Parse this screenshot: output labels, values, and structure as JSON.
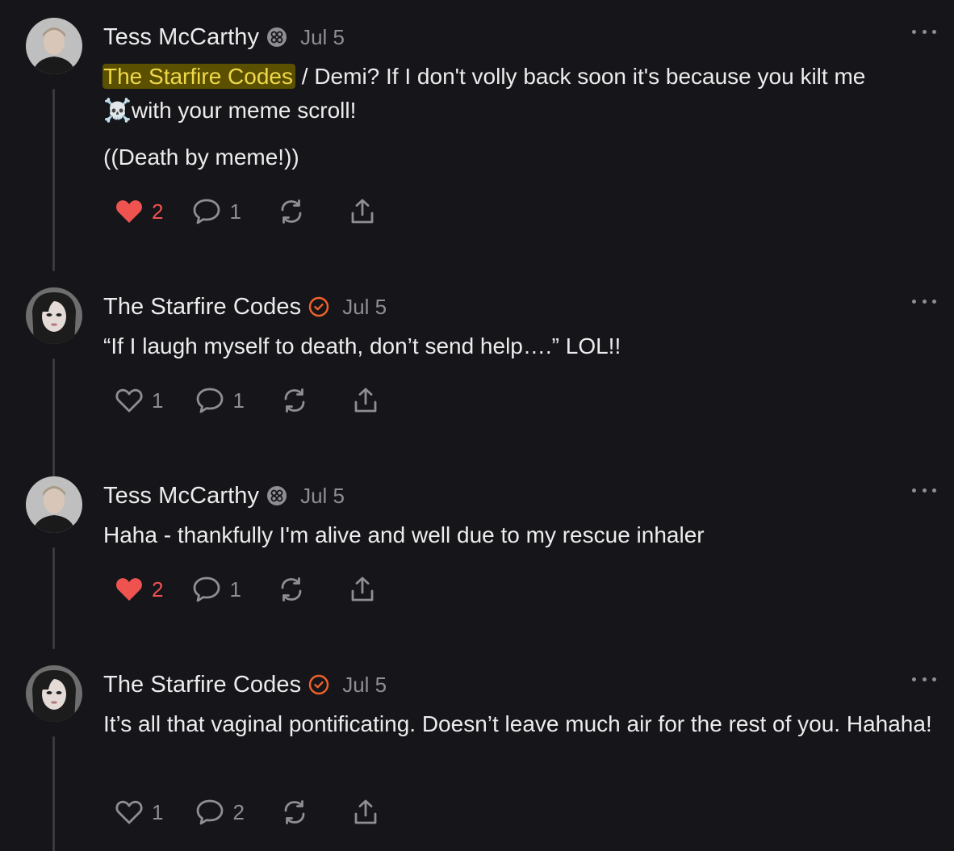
{
  "comments": [
    {
      "author": "Tess McCarthy",
      "date": "Jul 5",
      "mention": "The Starfire Codes",
      "line1": " / Demi? If I don't volly back soon it's because you kilt me ☠️with your meme scroll!",
      "line2": "((Death by meme!))",
      "likes": "2",
      "liked": true,
      "replies": "1"
    },
    {
      "author": "The Starfire Codes",
      "date": "Jul 5",
      "line1": "“If I laugh myself to death, don’t send help….” LOL!!",
      "likes": "1",
      "liked": false,
      "replies": "1"
    },
    {
      "author": "Tess McCarthy",
      "date": "Jul 5",
      "line1": "Haha - thankfully I'm alive and well due to my rescue inhaler",
      "likes": "2",
      "liked": true,
      "replies": "1"
    },
    {
      "author": "The Starfire Codes",
      "date": "Jul 5",
      "line1": "It’s all that vaginal pontificating. Doesn’t leave much air for the rest of you. Hahaha!",
      "likes": "1",
      "liked": false,
      "replies": "2"
    }
  ],
  "colors": {
    "background": "#16161a",
    "liked_heart": "#ef5350",
    "mention_text": "#f0d84a",
    "mention_bg": "#5a5000",
    "verified_badge": "#f0622a",
    "muted": "#8e8e93"
  },
  "icons": [
    "heart-icon",
    "comment-icon",
    "restack-icon",
    "share-icon",
    "more-icon",
    "founding-badge-icon",
    "verified-badge-icon"
  ]
}
